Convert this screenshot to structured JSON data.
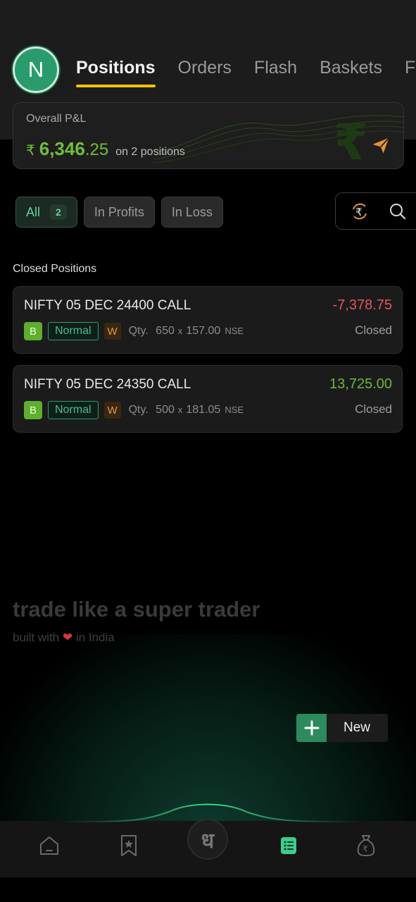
{
  "header": {
    "avatar_initial": "N",
    "tabs": [
      {
        "label": "Positions",
        "active": true
      },
      {
        "label": "Orders",
        "active": false
      },
      {
        "label": "Flash",
        "active": false
      },
      {
        "label": "Baskets",
        "active": false
      },
      {
        "label": "F",
        "active": false
      }
    ]
  },
  "pnl": {
    "label": "Overall P&L",
    "currency": "₹",
    "value_int": "6,346",
    "value_dec": ".25",
    "subtitle": "on 2 positions"
  },
  "filters": {
    "all_label": "All",
    "all_count": "2",
    "profits_label": "In Profits",
    "loss_label": "In Loss"
  },
  "section_title": "Closed Positions",
  "positions": [
    {
      "name": "NIFTY 05 DEC 24400 CALL",
      "pnl": "-7,378.75",
      "side": "B",
      "product": "Normal",
      "tag": "W",
      "qty_label": "Qty.",
      "qty": "650",
      "x": "x",
      "price": "157.00",
      "exchange": "NSE",
      "status": "Closed"
    },
    {
      "name": "NIFTY 05 DEC 24350 CALL",
      "pnl": "13,725.00",
      "side": "B",
      "product": "Normal",
      "tag": "W",
      "qty_label": "Qty.",
      "qty": "500",
      "x": "x",
      "price": "181.05",
      "exchange": "NSE",
      "status": "Closed"
    }
  ],
  "footer": {
    "tagline": "trade like a super trader",
    "built_prefix": "built with",
    "heart": "❤",
    "built_suffix": "in India",
    "new_label": "New",
    "logo_glyph": "ध"
  },
  "colors": {
    "profit": "#68b83c",
    "loss": "#e0575c",
    "accent": "#f2c200",
    "brand": "#2e8a5e"
  }
}
